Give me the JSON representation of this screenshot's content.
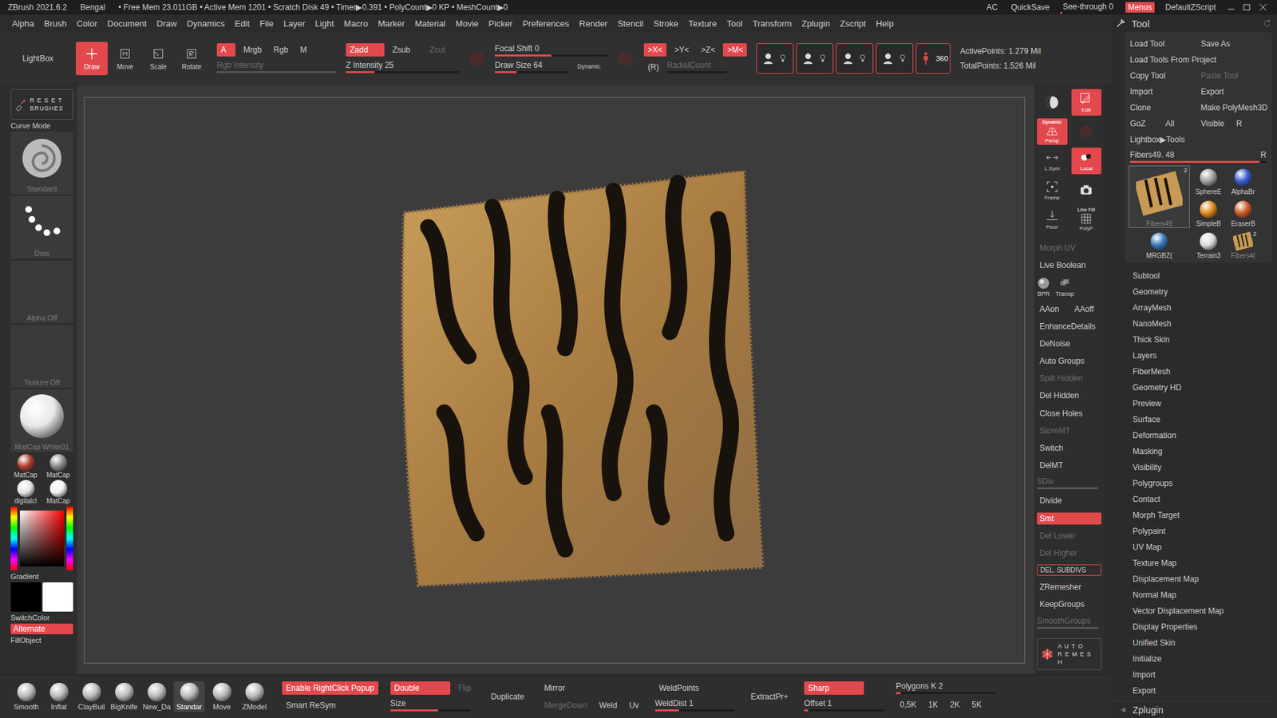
{
  "title_bar": {
    "app": "ZBrush 2021.6.2",
    "document": "Bengal",
    "stats": "• Free Mem 23.011GB • Active Mem 1201 • Scratch Disk 49 • Timer▶0.391 • PolyCount▶0 KP • MeshCount▶0",
    "items": [
      {
        "label": "AC",
        "kind": "text",
        "selected": false,
        "level": 0
      },
      {
        "label": "QuickSave",
        "kind": "text",
        "selected": false,
        "level": 0
      },
      {
        "label": "See-through  0",
        "kind": "slider",
        "selected": false,
        "level": 0
      },
      {
        "label": "Menus",
        "kind": "toggle",
        "selected": true,
        "level": 0
      },
      {
        "label": "DefaultZScript",
        "kind": "text",
        "selected": false,
        "level": 0
      }
    ]
  },
  "menu": [
    "Alpha",
    "Brush",
    "Color",
    "Document",
    "Draw",
    "Dynamics",
    "Edit",
    "File",
    "Layer",
    "Light",
    "Macro",
    "Marker",
    "Material",
    "Movie",
    "Picker",
    "Preferences",
    "Render",
    "Stencil",
    "Stroke",
    "Texture",
    "Tool",
    "Transform",
    "Zplugin",
    "Zscript",
    "Help"
  ],
  "top_shelf": {
    "lightbox": "LightBox",
    "modes": [
      {
        "label": "Draw",
        "selected": true
      },
      {
        "label": "Move",
        "selected": false
      },
      {
        "label": "Scale",
        "selected": false
      },
      {
        "label": "Rotate",
        "selected": false
      }
    ],
    "color_toggles": [
      {
        "label": "A",
        "selected": true,
        "disabled": false
      },
      {
        "label": "Mrgb",
        "selected": false,
        "disabled": false
      },
      {
        "label": "Rgb",
        "selected": false,
        "disabled": false
      },
      {
        "label": "M",
        "selected": false,
        "disabled": false
      }
    ],
    "rgb_intensity": {
      "label": "Rgb Intensity",
      "disabled": true,
      "level": 1
    },
    "z_toggles": [
      {
        "label": "Zadd",
        "selected": true,
        "disabled": false
      },
      {
        "label": "Zsub",
        "selected": false,
        "disabled": false
      },
      {
        "label": "Zcut",
        "selected": false,
        "disabled": true
      }
    ],
    "z_intensity": {
      "label": "Z Intensity 25",
      "disabled": false,
      "level": 0.25
    },
    "focal_shift": {
      "label": "Focal Shift 0",
      "disabled": false,
      "level": 0.5
    },
    "draw_size": {
      "label": "Draw Size 64",
      "disabled": false,
      "level": 0.3
    },
    "dynamic": "Dynamic",
    "symmetry": [
      {
        "label": ">X<",
        "selected": true
      },
      {
        "label": ">Y<",
        "selected": false
      },
      {
        "label": ">Z<",
        "selected": false
      },
      {
        "label": ">M<",
        "selected": true
      }
    ],
    "radial": "(R)",
    "radial_count": {
      "label": "RadialCount",
      "disabled": true,
      "level": 0
    },
    "view360": "360",
    "active_points": "ActivePoints: 1.279 Mil",
    "total_points": "TotalPoints: 1.526 Mil"
  },
  "left_shelf": {
    "reset": [
      "R E S E T",
      "BRUSHES"
    ],
    "curve_mode": "Curve Mode",
    "tiles": [
      {
        "label": "Standard",
        "kind": "brush"
      },
      {
        "label": "Dots",
        "kind": "stroke"
      },
      {
        "label": "Alpha Off",
        "kind": "empty"
      },
      {
        "label": "Texture Off",
        "kind": "empty"
      },
      {
        "label": "MatCap White01",
        "kind": "material"
      }
    ],
    "materials": [
      {
        "label": "MatCap",
        "color": "#b0402e"
      },
      {
        "label": "MatCap",
        "color": "#8a8a8a"
      },
      {
        "label": "digitalcl",
        "color": "#e6e6e6"
      },
      {
        "label": "MatCap",
        "color": "#f2f2f2"
      }
    ],
    "gradient": "Gradient",
    "switch_color": "SwitchColor",
    "alternate": {
      "label": "Alternate",
      "selected": true
    },
    "fill_object": "FillObject"
  },
  "right_shelf": {
    "tiles": [
      {
        "label": "",
        "caption": "",
        "selected": false
      },
      {
        "label": "Edit",
        "caption": "",
        "selected": true
      },
      {
        "label": "Persp",
        "caption": "Dynamic",
        "selected": true
      },
      {
        "label": "",
        "caption": "",
        "selected": false
      },
      {
        "label": "L.Sym",
        "caption": "",
        "selected": false
      },
      {
        "label": "Local",
        "caption": "",
        "selected": true
      },
      {
        "label": "Frame",
        "caption": "",
        "selected": false
      },
      {
        "label": "",
        "caption": "",
        "selected": false
      },
      {
        "label": "Floor",
        "caption": "",
        "selected": false
      },
      {
        "label": "PolyF",
        "caption": "Line Fill",
        "selected": false
      }
    ],
    "buttons": [
      {
        "kind": "text",
        "items": [
          {
            "label": "Morph UV",
            "selected": false,
            "disabled": true,
            "level": 0
          }
        ]
      },
      {
        "kind": "text",
        "items": [
          {
            "label": "Live Boolean",
            "selected": false,
            "disabled": false,
            "level": 0
          }
        ]
      },
      {
        "kind": "icons",
        "items": [
          {
            "label": "BPR",
            "selected": false,
            "disabled": false,
            "level": 0
          },
          {
            "label": "Transp",
            "selected": false,
            "disabled": false,
            "level": 0
          }
        ]
      },
      {
        "kind": "text",
        "items": [
          {
            "label": "AAon",
            "selected": false,
            "disabled": false,
            "level": 0
          },
          {
            "label": "AAoff",
            "selected": false,
            "disabled": false,
            "level": 0
          }
        ]
      },
      {
        "kind": "text",
        "items": [
          {
            "label": "EnhanceDetails",
            "selected": false,
            "disabled": false,
            "level": 0
          }
        ]
      },
      {
        "kind": "text",
        "items": [
          {
            "label": "DeNoise",
            "selected": false,
            "disabled": false,
            "level": 0
          }
        ]
      },
      {
        "kind": "text",
        "items": [
          {
            "label": "Auto Groups",
            "selected": false,
            "disabled": false,
            "level": 0
          }
        ]
      },
      {
        "kind": "text",
        "items": [
          {
            "label": "Split Hidden",
            "selected": false,
            "disabled": true,
            "level": 0
          }
        ]
      },
      {
        "kind": "text",
        "items": [
          {
            "label": "Del Hidden",
            "selected": false,
            "disabled": false,
            "level": 0
          }
        ]
      },
      {
        "kind": "text",
        "items": [
          {
            "label": "Close Holes",
            "selected": false,
            "disabled": false,
            "level": 0
          }
        ]
      },
      {
        "kind": "text",
        "items": [
          {
            "label": "StoreMT",
            "selected": false,
            "disabled": true,
            "level": 0
          }
        ]
      },
      {
        "kind": "text",
        "items": [
          {
            "label": "Switch",
            "selected": false,
            "disabled": false,
            "level": 0
          }
        ]
      },
      {
        "kind": "text",
        "items": [
          {
            "label": "DelMT",
            "selected": false,
            "disabled": false,
            "level": 0
          }
        ]
      },
      {
        "kind": "slider",
        "items": [
          {
            "label": "SDiv",
            "selected": false,
            "disabled": true,
            "level": 1
          }
        ]
      },
      {
        "kind": "text",
        "items": [
          {
            "label": "Divide",
            "selected": false,
            "disabled": false,
            "level": 0
          }
        ]
      },
      {
        "kind": "toggle",
        "items": [
          {
            "label": "Smt",
            "selected": true,
            "disabled": false,
            "level": 0
          }
        ]
      },
      {
        "kind": "text",
        "items": [
          {
            "label": "Del Lower",
            "selected": false,
            "disabled": true,
            "level": 0
          }
        ]
      },
      {
        "kind": "text",
        "items": [
          {
            "label": "Del Higher",
            "selected": false,
            "disabled": true,
            "level": 0
          }
        ]
      },
      {
        "kind": "outline",
        "items": [
          {
            "label": "DEL. SUBDIVS",
            "selected": false,
            "disabled": false,
            "level": 0
          }
        ]
      },
      {
        "kind": "text",
        "items": [
          {
            "label": "ZRemesher",
            "selected": false,
            "disabled": false,
            "level": 0
          }
        ]
      },
      {
        "kind": "text",
        "items": [
          {
            "label": "KeepGroups",
            "selected": false,
            "disabled": false,
            "level": 0
          }
        ]
      },
      {
        "kind": "slider",
        "items": [
          {
            "label": "SmoothGroups",
            "selected": false,
            "disabled": true,
            "level": 1
          }
        ]
      }
    ],
    "auto_remesh": [
      "A U T O",
      "R E M E S H"
    ]
  },
  "tool_panel": {
    "title": "Tool",
    "buttons": [
      [
        {
          "label": "Load Tool",
          "disabled": false
        },
        {
          "label": "Save As",
          "disabled": false
        }
      ],
      [
        {
          "label": "Load Tools From Project",
          "disabled": false
        }
      ],
      [
        {
          "label": "Copy Tool",
          "disabled": false
        },
        {
          "label": "Paste Tool",
          "disabled": true
        }
      ],
      [
        {
          "label": "Import",
          "disabled": false
        },
        {
          "label": "Export",
          "disabled": false
        }
      ],
      [
        {
          "label": "Clone",
          "disabled": false
        },
        {
          "label": "Make PolyMesh3D",
          "disabled": false
        }
      ],
      [
        {
          "label": "GoZ",
          "disabled": false
        },
        {
          "label": "All",
          "disabled": false
        },
        {
          "label": "Visible",
          "disabled": false
        },
        {
          "label": "R",
          "disabled": false
        }
      ],
      [
        {
          "label": "Lightbox▶Tools",
          "disabled": false
        }
      ]
    ],
    "current": {
      "label": "Fibers49. 48",
      "level": 0.95,
      "reset": "R"
    },
    "thumbnails": [
      {
        "label": "Fibers49",
        "badge": "2",
        "selected": true,
        "color": "#c79a55"
      },
      {
        "label": "SphereE",
        "badge": "",
        "selected": false,
        "color": "#a0a0a0"
      },
      {
        "label": "AlphaBr",
        "badge": "",
        "selected": false,
        "color": "#3b5bd6"
      },
      {
        "label": "SimpleB",
        "badge": "",
        "selected": false,
        "color": "#e08a1a"
      },
      {
        "label": "EraserB",
        "badge": "",
        "selected": false,
        "color": "#cc5a28"
      },
      {
        "label": "MRGBZ(",
        "badge": "",
        "selected": false,
        "color": "#3a7ac0"
      },
      {
        "label": "Terrain3",
        "badge": "",
        "selected": false,
        "color": "#dcdcdc"
      },
      {
        "label": "Fibers4(",
        "badge": "2",
        "selected": false,
        "color": "#c79a55"
      }
    ],
    "sections": [
      "Subtool",
      "Geometry",
      "ArrayMesh",
      "NanoMesh",
      "Thick Skin",
      "Layers",
      "FiberMesh",
      "Geometry HD",
      "Preview",
      "Surface",
      "Deformation",
      "Masking",
      "Visibility",
      "Polygroups",
      "Contact",
      "Morph Target",
      "Polypaint",
      "UV Map",
      "Texture Map",
      "Displacement Map",
      "Normal Map",
      "Vector Displacement Map",
      "Display Properties",
      "Unified Skin",
      "Initialize",
      "Import",
      "Export"
    ],
    "footer": "Zplugin"
  },
  "bottom_shelf": {
    "brushes": [
      {
        "label": "Smooth",
        "selected": false
      },
      {
        "label": "Inflat",
        "selected": false
      },
      {
        "label": "ClayBuil",
        "selected": false
      },
      {
        "label": "BigKnife",
        "selected": false
      },
      {
        "label": "New_Da",
        "selected": false
      },
      {
        "label": "Standar",
        "selected": true
      },
      {
        "label": "Move",
        "selected": false
      },
      {
        "label": "ZModel",
        "selected": false
      }
    ],
    "columns": [
      [
        [
          {
            "label": "Enable RightClick Popup",
            "kind": "toggle",
            "selected": true,
            "disabled": false,
            "level": 0
          }
        ],
        [
          {
            "label": "Smart ReSym",
            "kind": "text",
            "selected": false,
            "disabled": false,
            "level": 0
          }
        ]
      ],
      [
        [
          {
            "label": "Double",
            "kind": "toggle",
            "selected": true,
            "disabled": false,
            "level": 0
          },
          {
            "label": "Flip",
            "kind": "text",
            "selected": false,
            "disabled": true,
            "level": 0
          }
        ],
        [
          {
            "label": "Size",
            "kind": "slider",
            "selected": false,
            "disabled": false,
            "level": 0.6
          }
        ]
      ],
      [
        [
          {
            "label": "Duplicate",
            "kind": "text",
            "selected": false,
            "disabled": false,
            "level": 0
          }
        ]
      ],
      [
        [
          {
            "label": "Mirror",
            "kind": "text",
            "selected": false,
            "disabled": false,
            "level": 0
          }
        ],
        [
          {
            "label": "MergeDown",
            "kind": "text",
            "selected": false,
            "disabled": true,
            "level": 0
          },
          {
            "label": "Weld",
            "kind": "text",
            "selected": false,
            "disabled": false,
            "level": 0
          },
          {
            "label": "Uv",
            "kind": "text",
            "selected": false,
            "disabled": false,
            "level": 0
          }
        ]
      ],
      [
        [
          {
            "label": "WeldPoints",
            "kind": "text",
            "selected": false,
            "disabled": false,
            "level": 0
          }
        ],
        [
          {
            "label": "WeldDist 1",
            "kind": "slider",
            "selected": false,
            "disabled": false,
            "level": 0.3
          }
        ]
      ],
      [
        [
          {
            "label": "ExtractPr+",
            "kind": "text",
            "selected": false,
            "disabled": false,
            "level": 0
          }
        ]
      ],
      [
        [
          {
            "label": "Sharp",
            "kind": "toggle",
            "selected": true,
            "disabled": false,
            "level": 0
          }
        ],
        [
          {
            "label": "Offset 1",
            "kind": "slider",
            "selected": false,
            "disabled": false,
            "level": 0.05
          }
        ]
      ],
      [
        [
          {
            "label": "Polygons K 2",
            "kind": "slider",
            "selected": false,
            "disabled": false,
            "level": 0.05
          }
        ],
        [
          {
            "label": "0,5K",
            "kind": "text",
            "selected": false,
            "disabled": false,
            "level": 0
          },
          {
            "label": "1K",
            "kind": "text",
            "selected": false,
            "disabled": false,
            "level": 0
          },
          {
            "label": "2K",
            "kind": "text",
            "selected": false,
            "disabled": false,
            "level": 0
          },
          {
            "label": "5K",
            "kind": "text",
            "selected": false,
            "disabled": false,
            "level": 0
          }
        ]
      ]
    ]
  }
}
